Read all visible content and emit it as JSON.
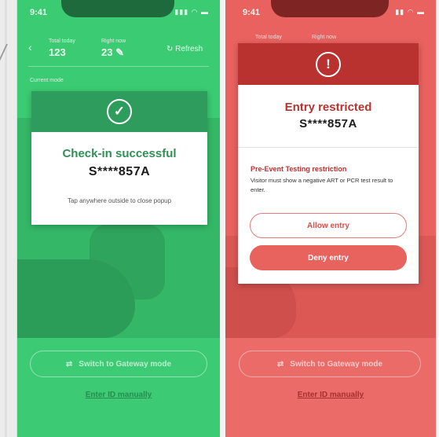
{
  "left_phone": {
    "status_time": "9:41",
    "status_icons": "▮▮▮ ◠ ▬",
    "header": {
      "back": "‹",
      "total_today_label": "Total today",
      "total_today_value": "123",
      "right_now_label": "Right now",
      "right_now_value": "23 ✎",
      "refresh_label": "↻ Refresh",
      "current_mode_label": "Current mode"
    },
    "modal": {
      "icon": "✓",
      "title": "Check-in successful",
      "id": "S****857A",
      "close_hint": "Tap anywhere outside to close popup"
    },
    "gateway_button": "Switch to Gateway mode",
    "gateway_icon": "⇄",
    "enter_manually": "Enter ID manually",
    "colors": {
      "overlay": "#3bcc73",
      "header": "#2e9c5d",
      "title": "#2f8f55"
    }
  },
  "right_phone": {
    "status_time": "9:41",
    "status_icons": "▮▮ ◠ ▬",
    "header": {
      "total_today_label": "Total today",
      "right_now_label": "Right now"
    },
    "modal": {
      "icon": "!",
      "title": "Entry restricted",
      "id": "S****857A",
      "subtitle": "Pre-Event Testing restriction",
      "description": "Visitor must show a negative ART or PCR test result to enter.",
      "allow_button": "Allow entry",
      "deny_button": "Deny entry"
    },
    "gateway_button": "Switch to Gateway mode",
    "gateway_icon": "⇄",
    "enter_manually": "Enter ID manually",
    "colors": {
      "overlay": "#e9625f",
      "header": "#b9322f",
      "deny": "#e8625e"
    }
  }
}
